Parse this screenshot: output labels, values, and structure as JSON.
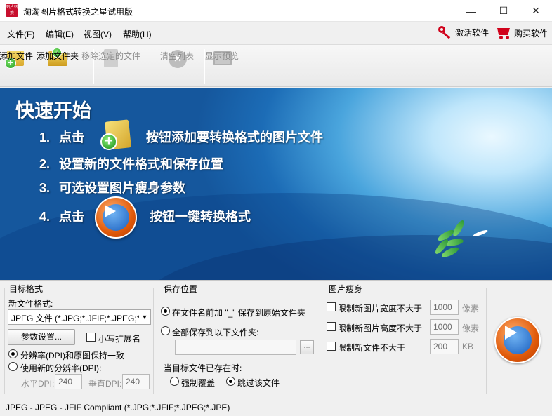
{
  "window": {
    "title": "淘淘图片格式转换之星试用版",
    "app_icon_text": "图片转换",
    "minimize_glyph": "—",
    "maximize_glyph": "☐",
    "close_glyph": "✕"
  },
  "menu": {
    "items": [
      "文件(F)",
      "编辑(E)",
      "视图(V)",
      "帮助(H)"
    ],
    "activate_label": "激活软件",
    "buy_label": "购买软件"
  },
  "toolbar": {
    "add_file": "添加文件",
    "add_folder": "添加文件夹",
    "remove_selected": "移除选定的文件",
    "clear_list": "清空列表",
    "show_preview": "显示预览"
  },
  "banner": {
    "title": "快速开始",
    "steps": [
      {
        "num": "1.",
        "before": "点击",
        "after": "按钮添加要转换格式的图片文件"
      },
      {
        "num": "2.",
        "text": "设置新的文件格式和保存位置"
      },
      {
        "num": "3.",
        "text": "可选设置图片瘦身参数"
      },
      {
        "num": "4.",
        "before": "点击",
        "after": "按钮一键转换格式"
      }
    ]
  },
  "target_format": {
    "group_title": "目标格式",
    "new_format_label": "新文件格式:",
    "format_value": "JPEG 文件 (*.JPG;*.JFIF;*.JPEG;*",
    "params_button": "参数设置...",
    "lowercase_ext_label": "小写扩展名",
    "lowercase_ext_checked": false,
    "dpi_keep_label": "分辨率(DPI)和原图保持一致",
    "dpi_new_label": "使用新的分辨率(DPI):",
    "dpi_mode": "keep",
    "h_dpi_label": "水平DPI:",
    "h_dpi_value": "240",
    "v_dpi_label": "垂直DPI:",
    "v_dpi_value": "240"
  },
  "save_location": {
    "group_title": "保存位置",
    "original_folder_label": "在文件名前加 \"_\" 保存到原始文件夹",
    "all_to_folder_label": "全部保存到以下文件夹:",
    "mode": "original",
    "folder_value": "",
    "browse_label": "...",
    "exists_label": "当目标文件已存在时:",
    "overwrite_label": "强制覆盖",
    "skip_label": "跳过该文件",
    "exists_mode": "skip"
  },
  "slimming": {
    "group_title": "图片瘦身",
    "width_label": "限制新图片宽度不大于",
    "width_value": "1000",
    "width_unit": "像素",
    "height_label": "限制新图片高度不大于",
    "height_value": "1000",
    "height_unit": "像素",
    "size_label": "限制新文件不大于",
    "size_value": "200",
    "size_unit": "KB"
  },
  "status": {
    "text": "JPEG - JPEG - JFIF Compliant (*.JPG;*.JFIF;*.JPEG;*.JPE)"
  },
  "colors": {
    "banner_deep": "#15579d",
    "banner_light": "#bfe6fb",
    "accent_red": "#d0021b",
    "orange": "#e05a0a"
  }
}
